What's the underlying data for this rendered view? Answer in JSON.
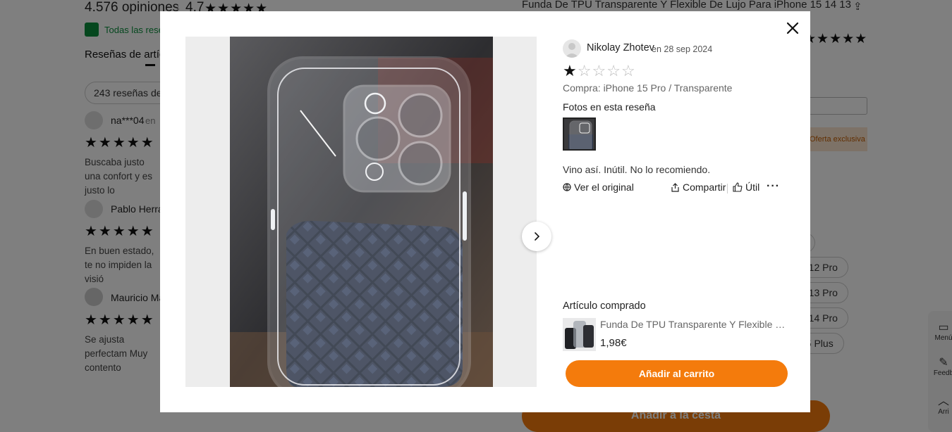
{
  "background": {
    "review_count": "4.576 opiniones",
    "rating_value": "4.7",
    "verified_text": "Todas las rese",
    "tab_label": "Reseñas de artíc",
    "filter_pill": "243 reseñas de",
    "reviews": [
      {
        "name": "na***04",
        "date_prefix": "en",
        "stars": "★★★★★",
        "text": "Buscaba justo una confort y es justo lo"
      },
      {
        "name": "Pablo Herra",
        "stars": "★★★★★",
        "text": "En buen estado, te no impiden la visió"
      },
      {
        "name": "Mauricio Ma",
        "stars": "★★★★★",
        "text": "Se ajusta perfectam Muy contento"
      }
    ],
    "product_title": "Funda De TPU Transparente Y Flexible De Lujo Para iPhone 15 14 13",
    "offer_text": "Oferta exclusiva",
    "size_options": [
      "e 12 Pro",
      "e 13 Pro",
      "e 14 Pro",
      "15 Plus"
    ],
    "cart_button": "Añadir a la cesta",
    "side_menu": "Menú",
    "side_feedback": "Feedb",
    "side_top": "Arri"
  },
  "modal": {
    "reviewer_name": "Nikolay Zhotev",
    "review_date": "en 28 sep 2024",
    "rating": 1,
    "rating_max": 5,
    "purchase_info": "Compra: iPhone 15 Pro / Transparente",
    "photos_label": "Fotos en esta reseña",
    "review_text": "Vino así. Inútil. No lo recomiendo.",
    "see_original": "Ver el original",
    "share_label": "Compartir",
    "useful_label": "Útil",
    "purchased_label": "Artículo comprado",
    "item_title": "Funda De TPU Transparente Y Flexible De Lujo Para iPhone 15 14 13",
    "item_price": "1,98€",
    "add_to_cart": "Añadir al carrito"
  },
  "colors": {
    "accent": "#f47b0c",
    "verified": "#0a8f3d"
  }
}
